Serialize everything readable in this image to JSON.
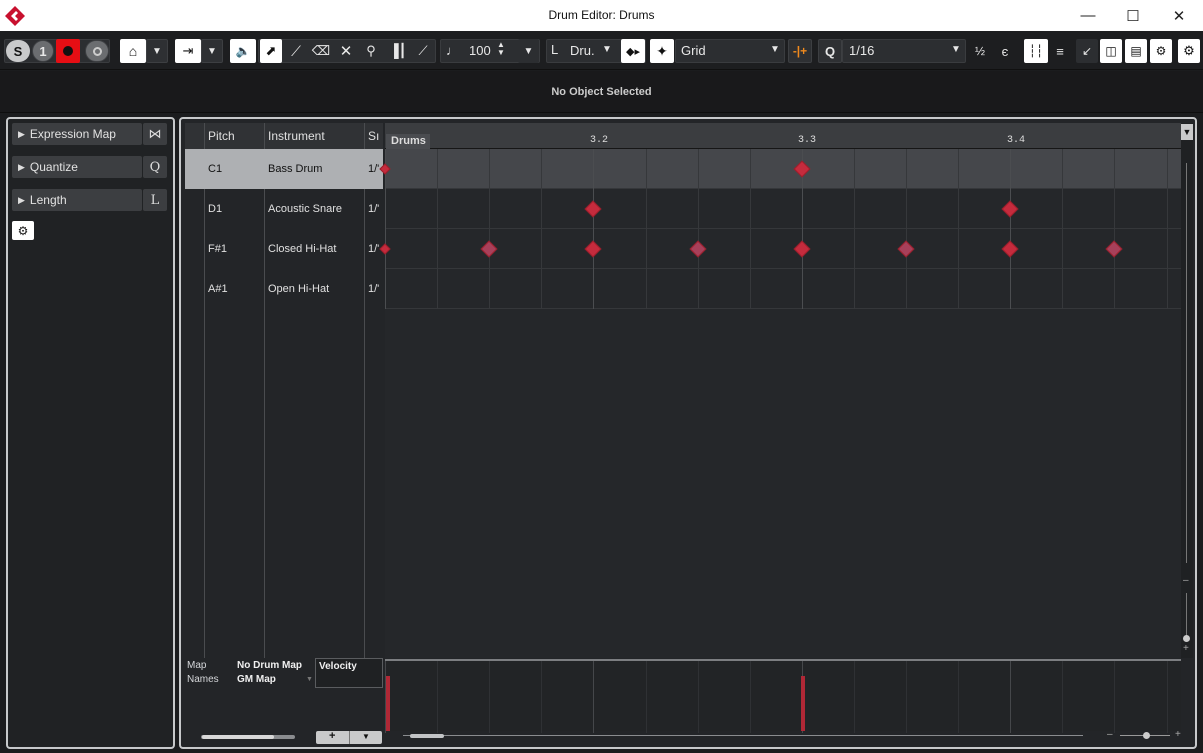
{
  "window": {
    "title": "Drum Editor: Drums",
    "app_icon": "cubase-logo-icon",
    "controls": [
      "minimize-icon",
      "maximize-icon",
      "close-icon"
    ]
  },
  "toolbar": {
    "tempo_value": "100",
    "drum_length_prefix": "L",
    "drum_length_value": "Dru.",
    "snap_label": "Grid",
    "quantize_label": "Q",
    "quantize_value": "1/16",
    "record_color": "#e60e14",
    "solo_label": "S",
    "one_label": "1"
  },
  "infobar": {
    "status": "No Object Selected"
  },
  "inspector": {
    "sections": [
      {
        "label": "Expression Map",
        "side": "⋈"
      },
      {
        "label": "Quantize",
        "side": "Q"
      },
      {
        "label": "Length",
        "side": "L"
      }
    ]
  },
  "drumlist": {
    "headers": {
      "pitch": "Pitch",
      "instrument": "Instrument",
      "snap": "Sı"
    },
    "rows": [
      {
        "pitch": "C1",
        "instrument": "Bass Drum",
        "snap": "1/'"
      },
      {
        "pitch": "D1",
        "instrument": "Acoustic Snare",
        "snap": "1/'"
      },
      {
        "pitch": "F#1",
        "instrument": "Closed Hi-Hat",
        "snap": "1/'"
      },
      {
        "pitch": "A#1",
        "instrument": "Open Hi-Hat",
        "snap": "1/'"
      }
    ],
    "map_label": "Map",
    "map_value": "No Drum Map",
    "names_label": "Names",
    "names_value": "GM Map",
    "velocity_label": "Velocity"
  },
  "grid": {
    "part_name": "Drums",
    "ruler_labels": [
      "3.2",
      "3.3",
      "3.4"
    ],
    "note_color": "#c52b3d",
    "note_color_soft": "#a8405a",
    "velocity_color": "#b02836"
  }
}
